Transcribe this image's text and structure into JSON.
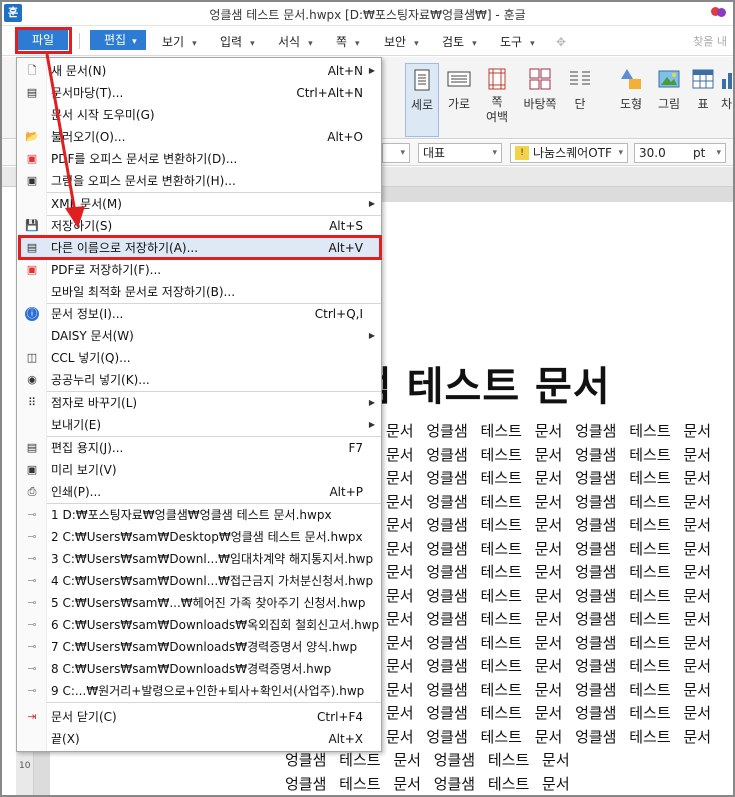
{
  "window": {
    "title": "엉클샘 테스트 문서.hwpx [D:₩포스팅자료₩엉클샘₩] - 훈글",
    "app_logo": "훈",
    "colors": {
      "accent": "#2d7bd3",
      "highlight": "#e02020"
    }
  },
  "menubar": {
    "file": "파일",
    "edit": "편집",
    "items": [
      "보기",
      "입력",
      "서식",
      "쪽",
      "보안",
      "검토",
      "도구"
    ],
    "find": "찾을 내"
  },
  "ribbon": {
    "buttons": [
      {
        "label": "세로",
        "icon": "portrait-page-icon"
      },
      {
        "label": "가로",
        "icon": "landscape-page-icon"
      },
      {
        "label": "쪽\n여백",
        "icon": "page-margin-icon"
      },
      {
        "label": "바탕쪽",
        "icon": "master-page-icon"
      },
      {
        "label": "단",
        "icon": "columns-icon"
      },
      {
        "label": "도형",
        "icon": "shape-icon"
      },
      {
        "label": "그림",
        "icon": "picture-icon"
      },
      {
        "label": "표",
        "icon": "table-icon"
      },
      {
        "label": "차",
        "icon": "chart-icon"
      }
    ]
  },
  "formatbar": {
    "style": "대표",
    "font": "나눔스퀘어OTF",
    "size": "30.0",
    "unit": "pt"
  },
  "ruler": {
    "vertical_number": "10"
  },
  "document": {
    "title": "샘 테스트 문서",
    "body_line": "엉클샘 테스트 문서 엉클샘 테스트 문서",
    "body_line_right": "문서 엉클샘 테스트 문서 엉클샘 테스트 문서"
  },
  "file_menu": {
    "items": [
      {
        "label": "새 문서(N)",
        "shortcut": "Alt+N",
        "icon": "new-document-icon",
        "submenu": true
      },
      {
        "label": "문서마당(T)...",
        "shortcut": "Ctrl+Alt+N",
        "icon": "template-icon"
      },
      {
        "label": "문서 시작 도우미(G)",
        "shortcut": "",
        "icon": ""
      },
      {
        "label": "불러오기(O)...",
        "shortcut": "Alt+O",
        "icon": "open-folder-icon"
      },
      {
        "label": "PDF를 오피스 문서로 변환하기(D)...",
        "shortcut": "",
        "icon": "pdf-convert-icon"
      },
      {
        "label": "그림을 오피스 문서로 변환하기(H)...",
        "shortcut": "",
        "icon": "image-convert-icon"
      },
      {
        "label": "XML 문서(M)",
        "shortcut": "",
        "icon": "",
        "submenu": true
      },
      {
        "label": "저장하기(S)",
        "shortcut": "Alt+S",
        "icon": "save-icon"
      },
      {
        "label": "다른 이름으로 저장하기(A)...",
        "shortcut": "Alt+V",
        "icon": "save-as-icon"
      },
      {
        "label": "PDF로 저장하기(F)...",
        "shortcut": "",
        "icon": "pdf-save-icon"
      },
      {
        "label": "모바일 최적화 문서로 저장하기(B)...",
        "shortcut": "",
        "icon": ""
      },
      {
        "label": "문서 정보(I)...",
        "shortcut": "Ctrl+Q,I",
        "icon": "info-icon"
      },
      {
        "label": "DAISY 문서(W)",
        "shortcut": "",
        "icon": "",
        "submenu": true
      },
      {
        "label": "CCL 넣기(Q)...",
        "shortcut": "",
        "icon": "ccl-icon"
      },
      {
        "label": "공공누리 넣기(K)...",
        "shortcut": "",
        "icon": "open-license-icon"
      },
      {
        "label": "점자로 바꾸기(L)",
        "shortcut": "",
        "icon": "braille-icon",
        "submenu": true
      },
      {
        "label": "보내기(E)",
        "shortcut": "",
        "icon": "",
        "submenu": true
      },
      {
        "label": "편집 용지(J)...",
        "shortcut": "F7",
        "icon": "page-setup-icon"
      },
      {
        "label": "미리 보기(V)",
        "shortcut": "",
        "icon": "preview-icon"
      },
      {
        "label": "인쇄(P)...",
        "shortcut": "Alt+P",
        "icon": "print-icon"
      },
      {
        "label": "1 D:₩포스팅자료₩엉클샘₩엉클샘 테스트 문서.hwpx",
        "shortcut": "",
        "icon": "pin-icon"
      },
      {
        "label": "2 C:₩Users₩sam₩Desktop₩엉클샘 테스트 문서.hwpx",
        "shortcut": "",
        "icon": "pin-icon"
      },
      {
        "label": "3 C:₩Users₩sam₩Downl...₩임대차계약 해지통지서.hwp",
        "shortcut": "",
        "icon": "pin-icon"
      },
      {
        "label": "4 C:₩Users₩sam₩Downl...₩접근금지 가처분신청서.hwp",
        "shortcut": "",
        "icon": "pin-icon"
      },
      {
        "label": "5 C:₩Users₩sam₩...₩헤어진 가족 찾아주기 신청서.hwp",
        "shortcut": "",
        "icon": "pin-icon"
      },
      {
        "label": "6 C:₩Users₩sam₩Downloads₩옥외집회 철회신고서.hwp",
        "shortcut": "",
        "icon": "pin-icon"
      },
      {
        "label": "7 C:₩Users₩sam₩Downloads₩경력증명서 양식.hwp",
        "shortcut": "",
        "icon": "pin-icon"
      },
      {
        "label": "8 C:₩Users₩sam₩Downloads₩경력증명서.hwp",
        "shortcut": "",
        "icon": "pin-icon"
      },
      {
        "label": "9 C:...₩원거리+발령으로+인한+퇴사+확인서(사업주).hwp",
        "shortcut": "",
        "icon": "pin-icon"
      },
      {
        "label": "문서 닫기(C)",
        "shortcut": "Ctrl+F4",
        "icon": "close-document-icon"
      },
      {
        "label": "끝(X)",
        "shortcut": "Alt+X",
        "icon": ""
      }
    ]
  }
}
